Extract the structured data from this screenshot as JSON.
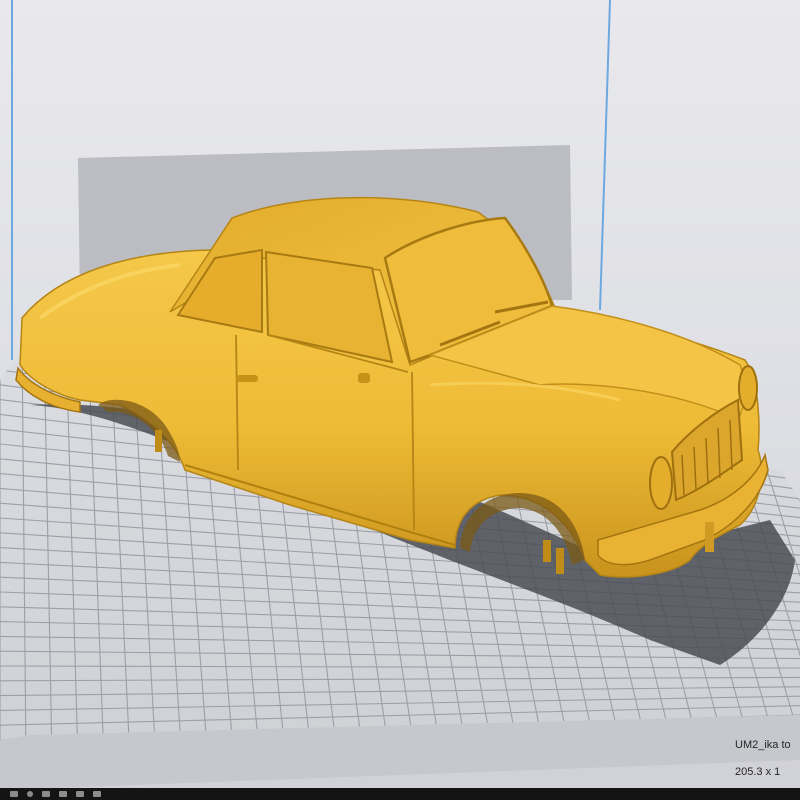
{
  "app": {
    "view": "3D build plate viewport"
  },
  "model": {
    "name": "UM2_ika to",
    "dimensions": "205.3 x 1"
  },
  "icons": {
    "model": "classic-car-model",
    "taskbar": [
      "start-icon",
      "search-icon",
      "app-icon",
      "app-icon",
      "app-icon",
      "app-icon"
    ]
  },
  "colors": {
    "model": "#f2be3a",
    "plate": "#d2d4d9",
    "grid": "#9aa0a8",
    "volume_edge": "#6ea8e0",
    "back_wall": "#bbbdc2"
  }
}
